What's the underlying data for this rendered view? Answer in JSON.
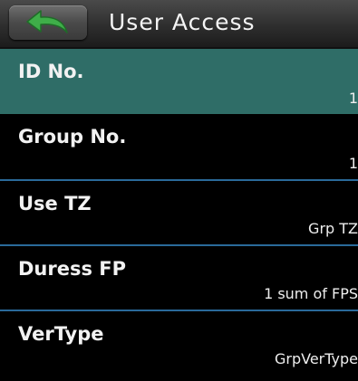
{
  "header": {
    "title": "User Access",
    "back_icon": "back-arrow-icon",
    "accent_color": "#3fae49"
  },
  "menu": {
    "items": [
      {
        "label": "ID No.",
        "value": "1",
        "selected": true
      },
      {
        "label": "Group No.",
        "value": "1",
        "selected": false
      },
      {
        "label": "Use TZ",
        "value": "Grp TZ",
        "selected": false
      },
      {
        "label": "Duress FP",
        "value": "1 sum of FPS",
        "selected": false
      },
      {
        "label": "VerType",
        "value": "GrpVerType",
        "selected": false
      }
    ],
    "selected_color": "#2f6d67",
    "divider_color": "#2a6a9a"
  }
}
